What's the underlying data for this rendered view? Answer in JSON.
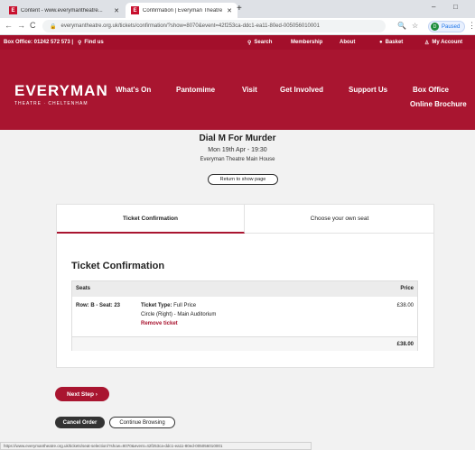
{
  "browser": {
    "tabs": [
      {
        "favicon": "E",
        "title": "Content - www.everymantheatre..."
      },
      {
        "favicon": "E",
        "title": "Confirmation | Everyman Theatre"
      }
    ],
    "new_tab": "+",
    "window_controls": {
      "minimize": "–",
      "maximize": "□",
      "close": "⋮"
    },
    "nav": {
      "back": "←",
      "forward": "→",
      "reload": "C"
    },
    "url": "everymantheatre.org.uk/tickets/confirmation/?show=8070&event=42f253ca-ddc1-ea11-80ed-005056010001",
    "profile": {
      "initial": "D",
      "label": "Paused"
    },
    "status_url": "https://www.everymantheatre.org.uk/tickets/seat-selection/?show=8070&event=42f253ca-ddc1-ea11-80ed-005056010001"
  },
  "site": {
    "topbar": {
      "box_office": "Box Office: 01242 572 573 |",
      "find_us": "Find us",
      "search": "Search",
      "membership": "Membership",
      "about": "About",
      "basket": "Basket",
      "my_account": "My Account"
    },
    "logo": {
      "name": "EVERYMAN",
      "sub": "THEATRE · CHELTENHAM"
    },
    "nav": {
      "whats_on": "What's On",
      "pantomime": "Pantomime",
      "visit": "Visit",
      "get_involved": "Get Involved",
      "support_us": "Support Us",
      "box_office": "Box Office",
      "online_brochure": "Online Brochure"
    },
    "colors": {
      "brand": "#a91530",
      "brand_dark": "#a30f2b"
    }
  },
  "event": {
    "title": "Dial M For Murder",
    "date": "Mon 19th Apr - 19:30",
    "venue": "Everyman Theatre Main House",
    "return_label": "Return to show page"
  },
  "tabs": {
    "confirmation": "Ticket Confirmation",
    "choose_seat": "Choose your own seat"
  },
  "confirmation": {
    "heading": "Ticket Confirmation",
    "col_seats": "Seats",
    "col_price": "Price",
    "ticket": {
      "seat": "Row: B - Seat: 23",
      "type_label": "Ticket Type:",
      "type_value": "Full Price",
      "area": "Circle (Right) - Main Auditorium",
      "remove": "Remove ticket",
      "price": "£38.00"
    },
    "total": "£38.00"
  },
  "actions": {
    "next": "Next Step ›",
    "cancel": "Cancel Order",
    "continue": "Continue Browsing"
  }
}
